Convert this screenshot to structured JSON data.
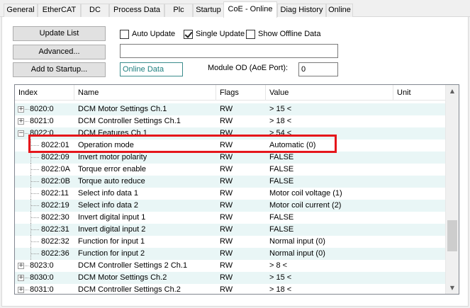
{
  "tabs": [
    "General",
    "EtherCAT",
    "DC",
    "Process Data",
    "Plc",
    "Startup",
    "CoE - Online",
    "Diag History",
    "Online"
  ],
  "active_tab": "CoE - Online",
  "buttons": {
    "update_list": "Update List",
    "advanced": "Advanced...",
    "add_to_startup": "Add to Startup..."
  },
  "checkboxes": {
    "auto_update": {
      "label": "Auto Update",
      "checked": false
    },
    "single_update": {
      "label": "Single Update",
      "checked": true
    },
    "show_offline": {
      "label": "Show Offline Data",
      "checked": false
    }
  },
  "status_field": "Online Data",
  "module_od_label": "Module OD (AoE Port):",
  "module_od_value": "0",
  "columns": {
    "index": "Index",
    "name": "Name",
    "flags": "Flags",
    "value": "Value",
    "unit": "Unit"
  },
  "rows": [
    {
      "index": "8020:0",
      "name": "DCM Motor Settings Ch.1",
      "flags": "RW",
      "value": "> 15 <",
      "expander": "+"
    },
    {
      "index": "8021:0",
      "name": "DCM Controller Settings Ch.1",
      "flags": "RW",
      "value": "> 18 <",
      "expander": "+"
    },
    {
      "index": "8022:0",
      "name": "DCM Features Ch.1",
      "flags": "RW",
      "value": "> 54 <",
      "expander": "-"
    },
    {
      "index": "8022:01",
      "name": "Operation mode",
      "flags": "RW",
      "value": "Automatic (0)",
      "child": true
    },
    {
      "index": "8022:09",
      "name": "Invert motor polarity",
      "flags": "RW",
      "value": "FALSE",
      "child": true
    },
    {
      "index": "8022:0A",
      "name": "Torque error enable",
      "flags": "RW",
      "value": "FALSE",
      "child": true
    },
    {
      "index": "8022:0B",
      "name": "Torque auto reduce",
      "flags": "RW",
      "value": "FALSE",
      "child": true
    },
    {
      "index": "8022:11",
      "name": "Select info data 1",
      "flags": "RW",
      "value": "Motor coil voltage (1)",
      "child": true
    },
    {
      "index": "8022:19",
      "name": "Select info data 2",
      "flags": "RW",
      "value": "Motor coil current (2)",
      "child": true
    },
    {
      "index": "8022:30",
      "name": "Invert digital input 1",
      "flags": "RW",
      "value": "FALSE",
      "child": true
    },
    {
      "index": "8022:31",
      "name": "Invert digital input 2",
      "flags": "RW",
      "value": "FALSE",
      "child": true
    },
    {
      "index": "8022:32",
      "name": "Function for input 1",
      "flags": "RW",
      "value": "Normal input (0)",
      "child": true
    },
    {
      "index": "8022:36",
      "name": "Function for input 2",
      "flags": "RW",
      "value": "Normal input (0)",
      "child": true
    },
    {
      "index": "8023:0",
      "name": "DCM Controller Settings 2 Ch.1",
      "flags": "RW",
      "value": "> 8 <",
      "expander": "+"
    },
    {
      "index": "8030:0",
      "name": "DCM Motor Settings Ch.2",
      "flags": "RW",
      "value": "> 15 <",
      "expander": "+"
    },
    {
      "index": "8031:0",
      "name": "DCM Controller Settings Ch.2",
      "flags": "RW",
      "value": "> 18 <",
      "expander": "+"
    }
  ],
  "highlighted_row": "8022:01",
  "colors": {
    "highlight": "#e5161b",
    "alt_row": "#e9f6f6",
    "status_text": "#1c7e7e"
  }
}
